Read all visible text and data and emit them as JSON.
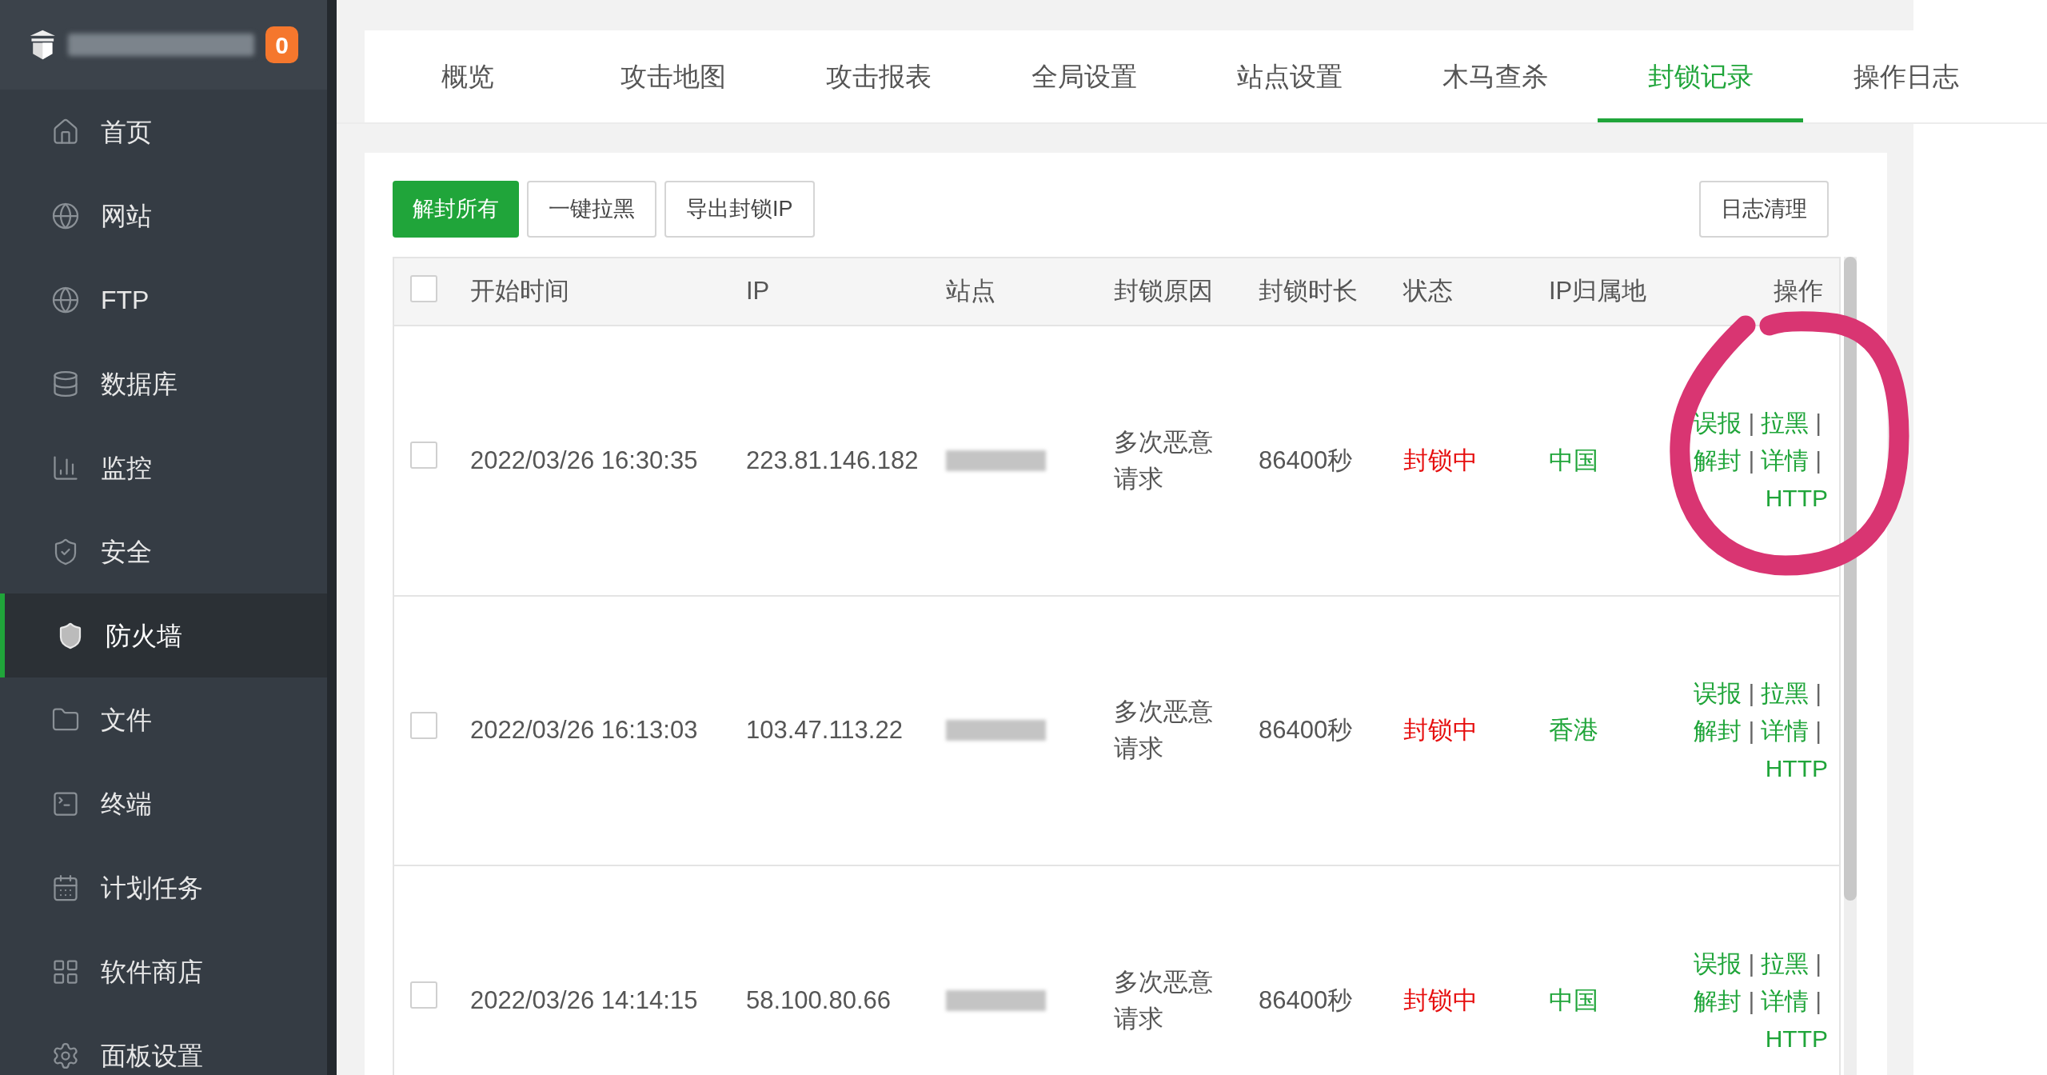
{
  "sidebar": {
    "badge": "0",
    "items": [
      {
        "label": "首页",
        "selected": false
      },
      {
        "label": "网站",
        "selected": false
      },
      {
        "label": "FTP",
        "selected": false
      },
      {
        "label": "数据库",
        "selected": false
      },
      {
        "label": "监控",
        "selected": false
      },
      {
        "label": "安全",
        "selected": false
      },
      {
        "label": "防火墙",
        "selected": true
      },
      {
        "label": "文件",
        "selected": false
      },
      {
        "label": "终端",
        "selected": false
      },
      {
        "label": "计划任务",
        "selected": false
      },
      {
        "label": "软件商店",
        "selected": false
      },
      {
        "label": "面板设置",
        "selected": false
      }
    ]
  },
  "tabs": [
    {
      "label": "概览",
      "selected": false
    },
    {
      "label": "攻击地图",
      "selected": false
    },
    {
      "label": "攻击报表",
      "selected": false
    },
    {
      "label": "全局设置",
      "selected": false
    },
    {
      "label": "站点设置",
      "selected": false
    },
    {
      "label": "木马查杀",
      "selected": false
    },
    {
      "label": "封锁记录",
      "selected": true
    },
    {
      "label": "操作日志",
      "selected": false
    }
  ],
  "toolbar": {
    "buttons": [
      {
        "label": "解封所有",
        "kind": "primary"
      },
      {
        "label": "一键拉黑",
        "kind": "default"
      },
      {
        "label": "导出封锁IP",
        "kind": "default"
      }
    ],
    "right_button": "日志清理"
  },
  "table": {
    "header_checked": false,
    "action_separator": "|",
    "columns": [
      "开始时间",
      "IP",
      "站点",
      "封锁原因",
      "封锁时长",
      "状态",
      "IP归属地",
      "操作"
    ],
    "rows": [
      {
        "checked": false,
        "start_time": "2022/03/26 16:30:35",
        "ip": "223.81.146.182",
        "reason": "多次恶意请求",
        "duration": "86400秒",
        "status": "封锁中",
        "location": "中国",
        "actions": [
          "误报",
          "拉黑",
          "解封",
          "详情",
          "HTTP"
        ]
      },
      {
        "checked": false,
        "start_time": "2022/03/26 16:13:03",
        "ip": "103.47.113.22",
        "reason": "多次恶意请求",
        "duration": "86400秒",
        "status": "封锁中",
        "location": "香港",
        "actions": [
          "误报",
          "拉黑",
          "解封",
          "详情",
          "HTTP"
        ]
      },
      {
        "checked": false,
        "start_time": "2022/03/26 14:14:15",
        "ip": "58.100.80.66",
        "reason": "多次恶意请求",
        "duration": "86400秒",
        "status": "封锁中",
        "location": "中国",
        "actions": [
          "误报",
          "拉黑",
          "解封",
          "详情",
          "HTTP"
        ]
      }
    ]
  }
}
